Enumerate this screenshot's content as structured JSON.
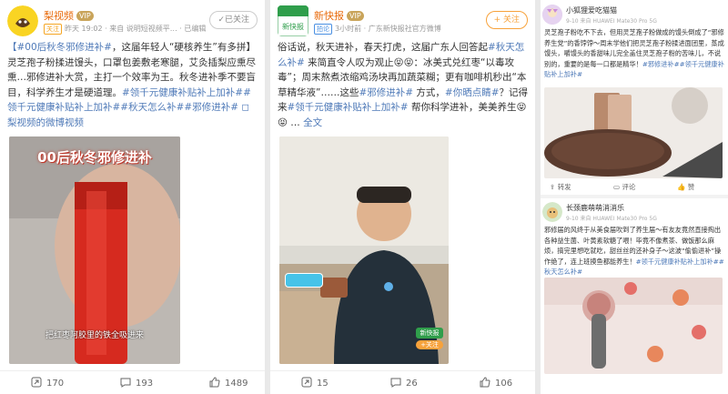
{
  "posts": [
    {
      "user": "梨视频",
      "vip": "VIP",
      "tag": "关注",
      "meta": "昨天 19:02 · 来自 说明短视频平… · 已编辑",
      "follow_label": "✓已关注",
      "text_parts": [
        {
          "t": "#00后秋冬邪修进补#",
          "h": true
        },
        {
          "t": "，这届年轻人“硬核养生”有多拼】灵芝孢子粉揉进馒头，口罩包姜敷老寒腿，艾灸插梨应熏尽熏…邪修进补大赏，主打一个效率为王。秋冬进补季不要盲目，科学养生才是硬道理。",
          "h": false
        },
        {
          "t": "#领千元健康补贴补上加补##领千元健康补贴补上加补##秋天怎么补##邪修进补#",
          "h": true
        },
        {
          "t": " ◻梨视频的微博视频",
          "h": true
        }
      ],
      "image_title": "00后秋冬邪修进补",
      "image_caption": "把红枣阿胶里的铁全吸进来",
      "reposts": "170",
      "comments": "193",
      "likes": "1489"
    },
    {
      "user": "新快报",
      "vip": "VIP",
      "tag": "拍论",
      "meta": "3小时前 · 广东新快报社官方微博",
      "follow_label": "+ 关注",
      "text_parts": [
        {
          "t": "俗话说，秋天进补，春天打虎，这届广东人回答起",
          "h": false
        },
        {
          "t": "#秋天怎么补#",
          "h": true
        },
        {
          "t": " 来简直令人叹为观止😝😝：冰美式兑红枣“以毒攻毒”；周末熬煮浓缩鸡汤块再加蔬菜糊；更有咖啡机秒出“本草精华液”……这些",
          "h": false
        },
        {
          "t": "#邪修进补#",
          "h": true
        },
        {
          "t": " 方式，",
          "h": false
        },
        {
          "t": "#你晒点睛#",
          "h": true
        },
        {
          "t": "？记得来",
          "h": false
        },
        {
          "t": "#领千元健康补贴补上加补#",
          "h": true
        },
        {
          "t": " 帮你科学进补，美美养生😝😝 … ",
          "h": false
        },
        {
          "t": "全文",
          "h": true
        }
      ],
      "image_badge": "新快报",
      "image_badge_sub": "+关注",
      "reposts": "15",
      "comments": "26",
      "likes": "106"
    }
  ],
  "side_cards": [
    {
      "user": "小狐狸爱吃猫猫",
      "meta": "9-10  来自 HUAWEI Mate30 Pro 5G",
      "text": "灵芝孢子粉吃不下去，但用灵芝孢子粉做成的馒头倒成了“邪修养生党”的香饽饽～周末学他们把灵芝孢子粉揉进面团里，蒸成馒头，嚼馒头的香甜味儿完全盖住灵芝孢子粉的苦味儿，不说别的，重要的是每一口都是精华！",
      "hashtags": "#邪修进补##领千元健康补贴补上加补#",
      "repost": "转发",
      "comment": "评论",
      "like": "赞"
    },
    {
      "user": "长颈鹿萌萌消消乐",
      "meta": "9-10  来自 HUAWEI Mate30 Pro 5G",
      "text": "邪修届的风终于从美食届吹到了养生届～有友友竟然直接掏出各种益生菌、叶黄素软糖了喂！毕竟不像煮茶、做饭那么麻烦，搞完里想吃就吃，甜丝丝的还补身子～这波“偷偷进补”操作绝了，连上班摸鱼都能养生！",
      "hashtags": "#领千元健康补贴补上加补##秋天怎么补#"
    }
  ],
  "colors": {
    "accent": "#f7a23b",
    "hashtag": "#4f7ab8",
    "name": "#e86b0c"
  }
}
